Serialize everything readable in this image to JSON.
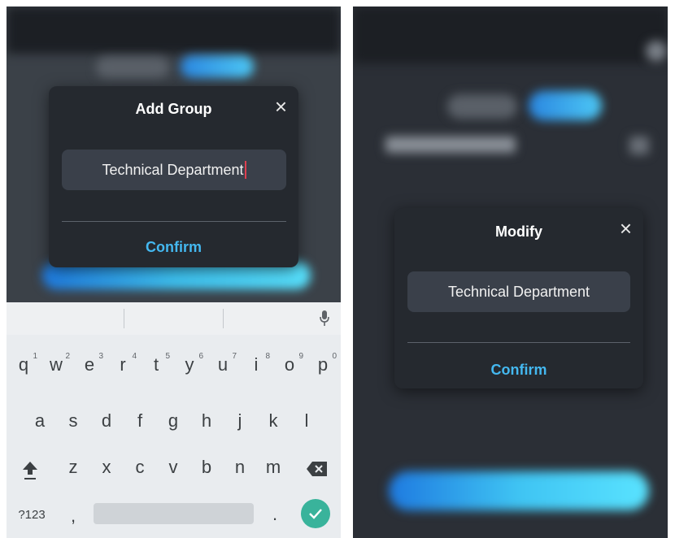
{
  "left_screen": {
    "dialog": {
      "title": "Add Group",
      "close_symbol": "×",
      "input_value": "Technical Department",
      "confirm_label": "Confirm"
    },
    "keyboard": {
      "row1": [
        {
          "key": "q",
          "hint": "1"
        },
        {
          "key": "w",
          "hint": "2"
        },
        {
          "key": "e",
          "hint": "3"
        },
        {
          "key": "r",
          "hint": "4"
        },
        {
          "key": "t",
          "hint": "5"
        },
        {
          "key": "y",
          "hint": "6"
        },
        {
          "key": "u",
          "hint": "7"
        },
        {
          "key": "i",
          "hint": "8"
        },
        {
          "key": "o",
          "hint": "9"
        },
        {
          "key": "p",
          "hint": "0"
        }
      ],
      "row2": [
        "a",
        "s",
        "d",
        "f",
        "g",
        "h",
        "j",
        "k",
        "l"
      ],
      "row3": [
        "z",
        "x",
        "c",
        "v",
        "b",
        "n",
        "m"
      ],
      "symbols_key": "?123",
      "comma_key": ",",
      "period_key": ".",
      "icons": [
        "mic-icon",
        "shift-icon",
        "backspace-icon",
        "checkmark-icon"
      ]
    }
  },
  "right_screen": {
    "dialog": {
      "title": "Modify",
      "close_symbol": "×",
      "input_value": "Technical Department",
      "confirm_label": "Confirm"
    }
  },
  "colors": {
    "dialog_bg": "#25292f",
    "input_bg": "#3a404a",
    "confirm_text": "#44b8f0",
    "accent_gradient_start": "#1e7ae0",
    "accent_gradient_end": "#59e3ff",
    "enter_key": "#39b39b",
    "keyboard_bg": "#e9ecef"
  }
}
